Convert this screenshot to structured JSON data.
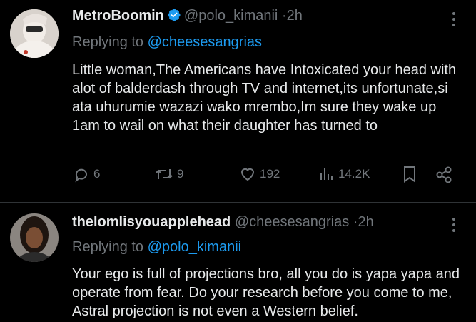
{
  "tweets": [
    {
      "display_name": "MetroBoomin",
      "handle": "@polo_kimanii",
      "separator": "·",
      "time": "2h",
      "replying_prefix": "Replying to",
      "replying_to": "@cheesesangrias",
      "text": "Little woman,The Americans have Intoxicated your head with alot of balderdash through TV and internet,its unfortunate,si ata uhurumie wazazi wako mrembo,Im sure they wake up 1am to wail on what their daughter has turned to",
      "reply_count": "6",
      "repost_count": "9",
      "like_count": "192",
      "view_count": "14.2K"
    },
    {
      "display_name": "thelomlisyouapplehead",
      "handle": "@cheesesangrias",
      "separator": "·",
      "time": "2h",
      "replying_prefix": "Replying to",
      "replying_to": "@polo_kimanii",
      "text": "Your ego is full of projections bro, all you do is yapa yapa and operate from fear. Do your research before you come to me, Astral projection is not even a Western belief."
    }
  ],
  "colors": {
    "background": "#000000",
    "text": "#e7e9ea",
    "muted": "#71767b",
    "mention": "#1d9bf0",
    "verified": "#1d9bf0"
  },
  "icons": [
    "more-icon",
    "verified-icon",
    "reply-icon",
    "repost-icon",
    "like-icon",
    "views-icon",
    "bookmark-icon",
    "share-icon"
  ]
}
